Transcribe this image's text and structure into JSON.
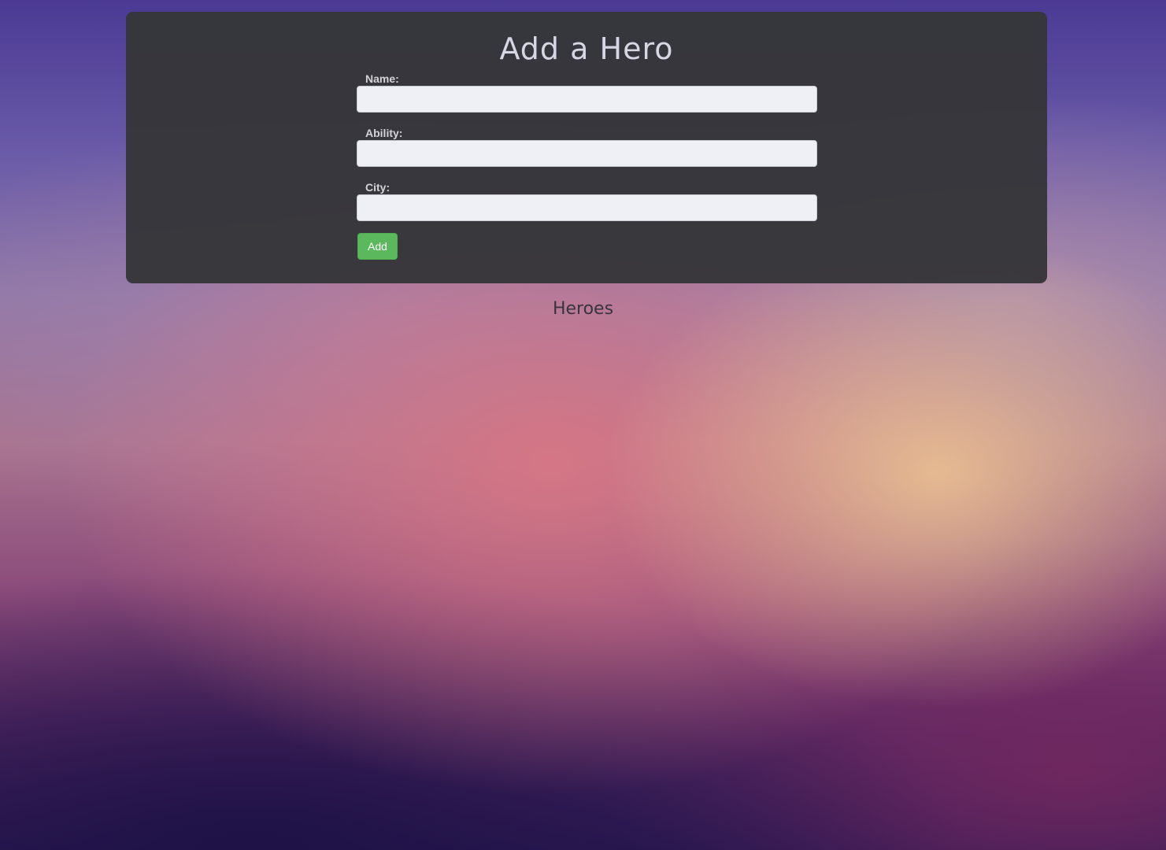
{
  "form": {
    "title": "Add a Hero",
    "fields": [
      {
        "label": "Name:",
        "value": "",
        "placeholder": ""
      },
      {
        "label": "Ability:",
        "value": "",
        "placeholder": ""
      },
      {
        "label": "City:",
        "value": "",
        "placeholder": ""
      }
    ],
    "submit_label": "Add"
  },
  "list": {
    "heading": "Heroes"
  },
  "colors": {
    "panel_background": "#36363a",
    "button_green": "#5cb85c",
    "input_background": "#efeff6",
    "label_text": "#d4d4d8"
  }
}
